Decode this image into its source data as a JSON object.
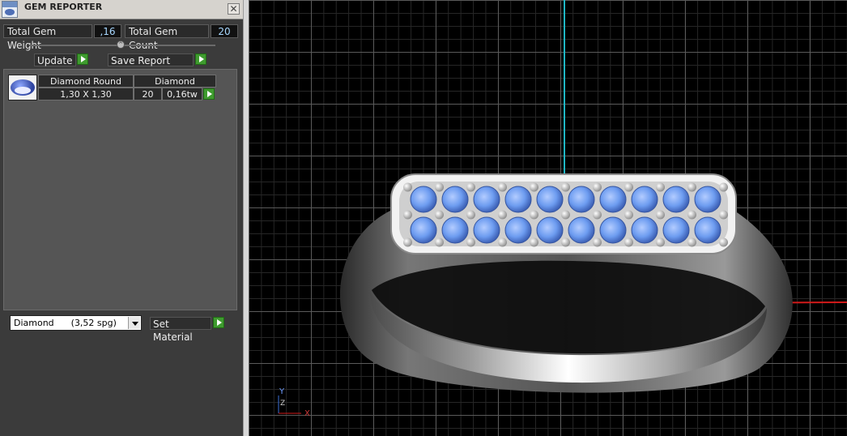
{
  "window": {
    "title": "GEM REPORTER",
    "close_icon": "close-icon"
  },
  "summary": {
    "total_weight_label": "Total Gem Weight",
    "total_weight_value": ",16",
    "total_count_label": "Total Gem Count",
    "total_count_value": "20"
  },
  "actions": {
    "update_label": "Update",
    "save_report_label": "Save Report"
  },
  "gem_list": [
    {
      "thumbnail_icon": "round-diamond-icon",
      "shape": "Diamond Round",
      "material": "Diamond",
      "size": "1,30 X 1,30",
      "count": "20",
      "weight": "0,16tw"
    }
  ],
  "material_select": {
    "selected": "Diamond      (3,52 spg)",
    "set_material_label": "Set Material"
  },
  "viewport": {
    "axis_labels": {
      "y": "Y",
      "z": "Z",
      "x": "X"
    },
    "colors": {
      "grid_major": "#5a5a5a",
      "grid_minor": "#262626",
      "y_axis": "#1fb6c4",
      "x_axis": "#d21a1a",
      "gem": "#6d9cf0",
      "metal": "#c8c8c8"
    }
  }
}
